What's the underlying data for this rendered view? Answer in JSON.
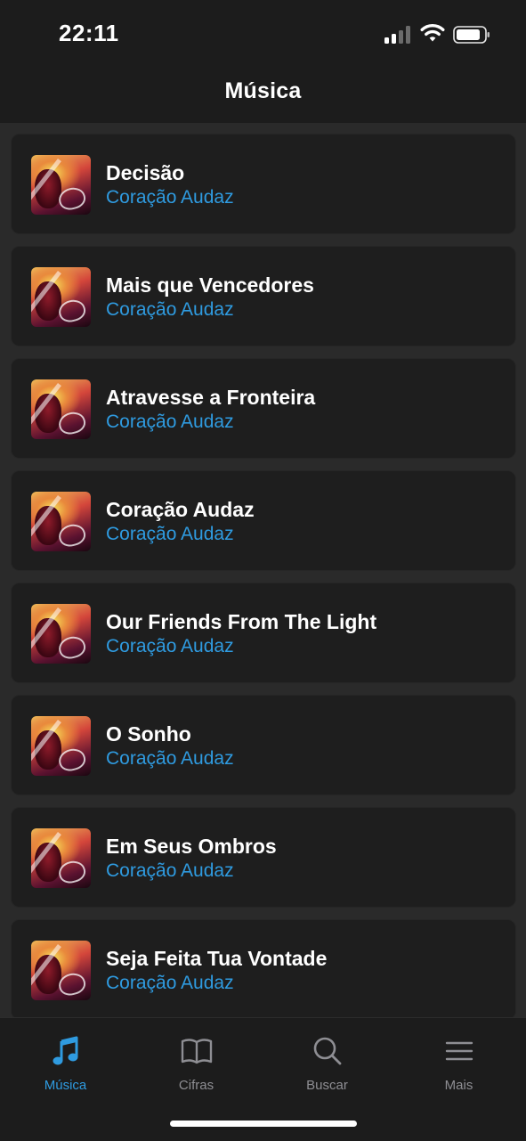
{
  "status_bar": {
    "time": "22:11"
  },
  "header": {
    "title": "Música"
  },
  "songs": [
    {
      "title": "Decisão",
      "artist": "Coração Audaz"
    },
    {
      "title": "Mais que Vencedores",
      "artist": "Coração Audaz"
    },
    {
      "title": "Atravesse a Fronteira",
      "artist": "Coração Audaz"
    },
    {
      "title": "Coração Audaz",
      "artist": "Coração Audaz"
    },
    {
      "title": "Our Friends From The Light",
      "artist": "Coração Audaz"
    },
    {
      "title": "O Sonho",
      "artist": "Coração Audaz"
    },
    {
      "title": "Em Seus Ombros",
      "artist": "Coração Audaz"
    },
    {
      "title": "Seja Feita Tua Vontade",
      "artist": "Coração Audaz"
    }
  ],
  "tab_bar": {
    "tabs": [
      {
        "label": "Música",
        "icon": "music-note-icon",
        "active": true
      },
      {
        "label": "Cifras",
        "icon": "book-icon",
        "active": false
      },
      {
        "label": "Buscar",
        "icon": "search-icon",
        "active": false
      },
      {
        "label": "Mais",
        "icon": "menu-icon",
        "active": false
      }
    ]
  },
  "colors": {
    "accent": "#2f9be0",
    "background": "#2a2a2a",
    "card": "#1e1e1e",
    "bar": "#1c1c1c",
    "inactive_tab": "#8e8e93"
  }
}
